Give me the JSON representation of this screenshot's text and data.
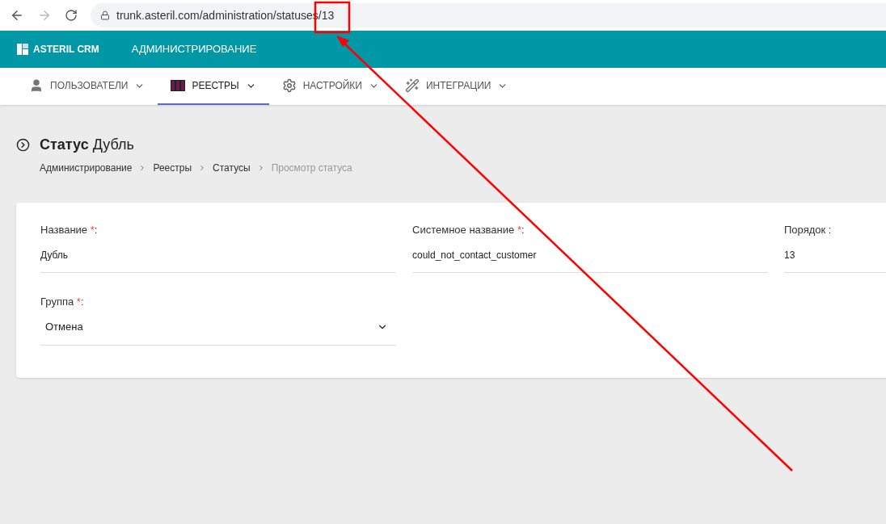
{
  "browser": {
    "url": "trunk.asteril.com/administration/statuses/13"
  },
  "header": {
    "logo": "ASTERIL CRM",
    "section": "АДМИНИСТРИРОВАНИЕ"
  },
  "nav": [
    {
      "label": "ПОЛЬЗОВАТЕЛИ",
      "kind": "user",
      "selected": false
    },
    {
      "label": "РЕЕСТРЫ",
      "kind": "binders",
      "selected": true
    },
    {
      "label": "НАСТРОЙКИ",
      "kind": "gear",
      "selected": false
    },
    {
      "label": "ИНТЕГРАЦИИ",
      "kind": "wand",
      "selected": false
    }
  ],
  "page": {
    "title_bold": "Статус",
    "title_rest": "Дубль",
    "breadcrumbs": [
      {
        "label": "Администрирование",
        "current": false
      },
      {
        "label": "Реестры",
        "current": false
      },
      {
        "label": "Статусы",
        "current": false
      },
      {
        "label": "Просмотр статуса",
        "current": true
      }
    ]
  },
  "form": {
    "rows": [
      [
        {
          "kind": "text",
          "label": "Название",
          "required_mark": "*",
          "suffix": ":",
          "value": "Дубль"
        },
        {
          "kind": "text",
          "label": "Системное название",
          "required_mark": "*",
          "suffix": ":",
          "value": "could_not_contact_customer"
        },
        {
          "kind": "text",
          "label": "Порядок :",
          "value": "13"
        }
      ],
      [
        {
          "kind": "select",
          "label": "Группа",
          "required_mark": "*",
          "suffix": ":",
          "value": "Отмена"
        }
      ]
    ]
  },
  "annotation": {
    "highlight_frame": true,
    "arrow": true
  }
}
